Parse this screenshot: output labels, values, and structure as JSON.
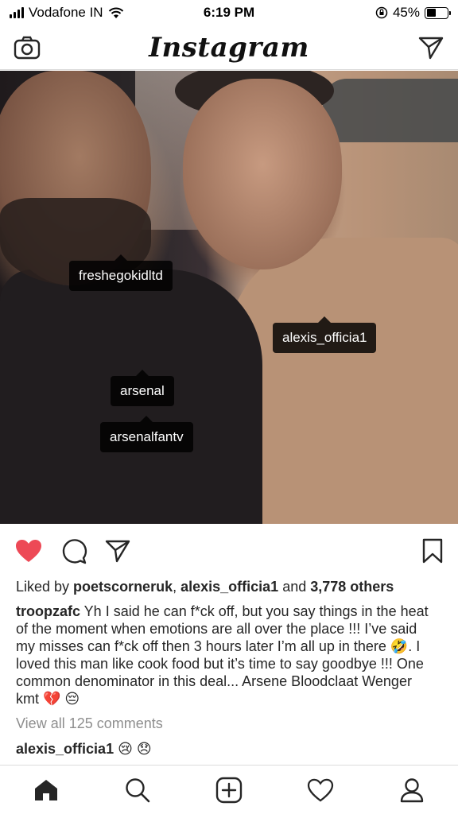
{
  "status_bar": {
    "carrier": "Vodafone IN",
    "time": "6:19 PM",
    "battery_text": "45%",
    "battery_level": 0.45
  },
  "header": {
    "logo": "Instagram",
    "left_icon": "camera-icon",
    "right_icon": "direct-message-icon"
  },
  "photo": {
    "tags": [
      {
        "label": "freshegokidltd"
      },
      {
        "label": "alexis_officia1"
      },
      {
        "label": "arsenal"
      },
      {
        "label": "arsenalfantv"
      }
    ]
  },
  "actions": {
    "like_icon": "heart-filled-icon",
    "like_color": "#ed4956",
    "comment_icon": "comment-icon",
    "share_icon": "share-icon",
    "save_icon": "bookmark-icon"
  },
  "likes": {
    "prefix": "Liked by ",
    "user1": "poetscorneruk",
    "sep": ", ",
    "user2": "alexis_officia1",
    "and": " and ",
    "others": "3,778 others"
  },
  "caption": {
    "username": "troopzafc",
    "text": " Yh I said he can f*ck off, but you say things in the heat of the moment when emotions are all over the place !!! I’ve said my misses can f*ck off then 3 hours later I’m all up in there 🤣. I loved this man like cook food but it’s time to say goodbye !!! One common denominator in this deal... Arsene Bloodclaat Wenger kmt 💔 😔"
  },
  "view_comments": "View all 125 comments",
  "comment": {
    "username": "alexis_officia1",
    "text": " 😢 😞"
  },
  "tabbar": {
    "items": [
      "home-icon",
      "search-icon",
      "new-post-icon",
      "activity-icon",
      "profile-icon"
    ]
  }
}
